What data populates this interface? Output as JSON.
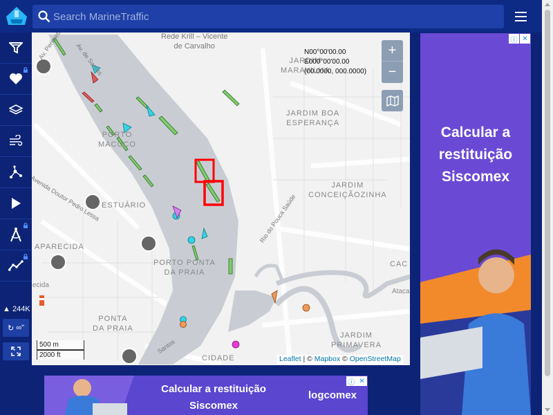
{
  "header": {
    "search_placeholder": "Search MarineTraffic"
  },
  "sidebar": {
    "items": [
      {
        "name": "filter-icon",
        "locked": false
      },
      {
        "name": "heart-icon",
        "locked": true
      },
      {
        "name": "layers-icon",
        "locked": false
      },
      {
        "name": "wind-icon",
        "locked": false
      },
      {
        "name": "network-icon",
        "locked": false
      },
      {
        "name": "play-icon",
        "locked": false
      },
      {
        "name": "compass-icon",
        "locked": true
      },
      {
        "name": "chart-line-icon",
        "locked": true
      }
    ],
    "vessel_count": "244K",
    "refresh_label": "∞\"",
    "fullscreen_icon": "expand-icon"
  },
  "map": {
    "coords": {
      "lat": "N00°00'00.00",
      "lon": "E000°00'00.00",
      "decimal": "(00.0000, 000.0000)"
    },
    "zoom_in": "+",
    "zoom_out": "−",
    "scale": {
      "metric": "500 m",
      "imperial": "2000 ft"
    },
    "attribution": {
      "leaflet": "Leaflet",
      "sep1": " | © ",
      "mapbox": "Mapbox",
      "sep2": " © ",
      "osm": "OpenStreetMap"
    },
    "labels": [
      "Rede Krill – Vicente",
      "de Carvalho",
      "JARDIM",
      "MARAVILHA",
      "JARDIM BOA",
      "ESPERANÇA",
      "PORTO",
      "MACUCO",
      "JARDIM",
      "CONCEIÇÃOZINHA",
      "ESTUÁRIO",
      "APARECIDA",
      "PORTO PONTA",
      "DA PRAIA",
      "PONTA",
      "DA PRAIA",
      "JARDIM",
      "PRIMAVERA",
      "CIDADE",
      "Rio do Pouca Saúde",
      "Avenida Doutor Pedro Lessa",
      "Av. Perimetral",
      "Av. de Santos",
      "Santos",
      "CAC",
      "Ataca",
      "ecida"
    ]
  },
  "ads": {
    "right": {
      "headline": "Calcular a restituição Siscomex"
    },
    "bottom": {
      "headline": "Calcular a restituição Siscomex",
      "brand": "logcomex"
    }
  },
  "colors": {
    "nav_bg": "#0c2376",
    "topbar_bg": "#0d2a85",
    "water": "#c9cdd3",
    "cargo_vessel": "#7ecb6e",
    "passenger_vessel": "#36d1e3",
    "tanker_vessel": "#e05a5a",
    "highlight": "#ff0000"
  }
}
